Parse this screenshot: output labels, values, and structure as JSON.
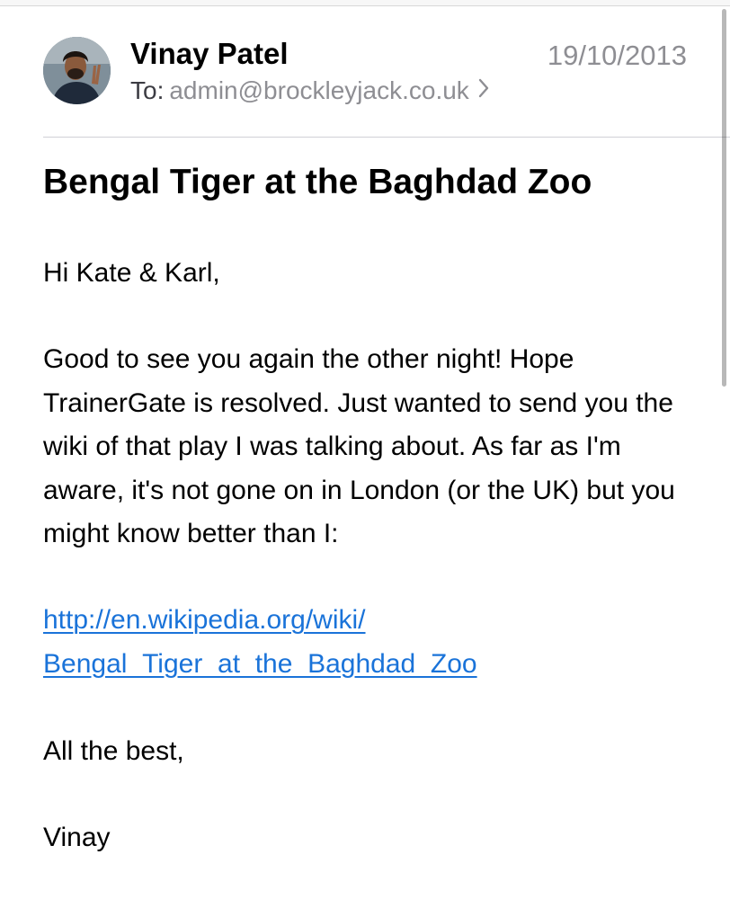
{
  "email": {
    "sender_name": "Vinay Patel",
    "date": "19/10/2013",
    "to_label": "To:",
    "to_address": "admin@brockleyjack.co.uk",
    "subject": "Bengal Tiger at the Baghdad Zoo",
    "greeting": "Hi Kate & Karl,",
    "paragraph": "Good to see you again the other night! Hope TrainerGate is resolved. Just wanted to send you the wiki of that play I was talking about. As far as I'm aware, it's not gone on in London (or the UK) but you might know better than I:",
    "link_line_1": "http://en.wikipedia.org/wiki/",
    "link_line_2": "Bengal_Tiger_at_the_Baghdad_Zoo",
    "signoff": "All the best,",
    "signature": "Vinay"
  },
  "icons": {
    "avatar": "sender-avatar-photo",
    "recipient_chevron": "chevron-right-icon"
  },
  "colors": {
    "link": "#1a73d9",
    "secondary_text": "#8e8e93",
    "divider": "#d1d1d6"
  }
}
